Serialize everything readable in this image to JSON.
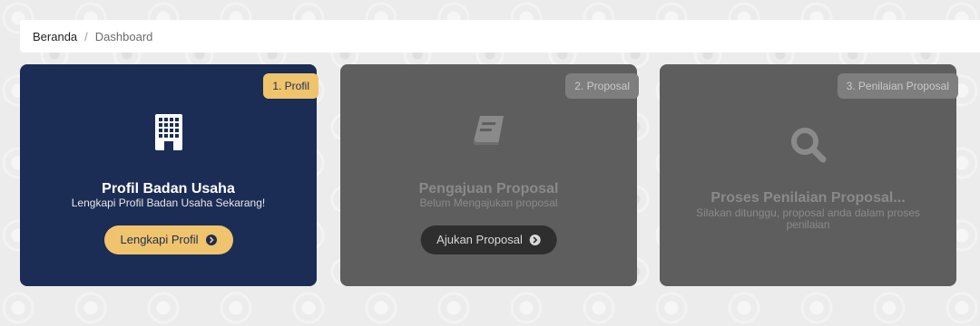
{
  "breadcrumb": {
    "home": "Beranda",
    "separator": "/",
    "current": "Dashboard"
  },
  "cards": [
    {
      "step": "1. Profil",
      "icon": "building-icon",
      "title": "Profil Badan Usaha",
      "subtitle": "Lengkapi Profil Badan Usaha Sekarang!",
      "button": "Lengkapi Profil",
      "state": "active",
      "color": "#1b2d55",
      "accent": "#f0c46d"
    },
    {
      "step": "2. Proposal",
      "icon": "book-icon",
      "title": "Pengajuan Proposal",
      "subtitle": "Belum Mengajukan proposal",
      "button": "Ajukan Proposal",
      "state": "disabled",
      "color": "#5e5e5e"
    },
    {
      "step": "3. Penilaian Proposal",
      "icon": "search-icon",
      "title": "Proses Penilaian Proposal...",
      "subtitle": "Silakan ditunggu, proposal anda dalam proses penilaian",
      "state": "disabled",
      "color": "#5e5e5e"
    }
  ]
}
